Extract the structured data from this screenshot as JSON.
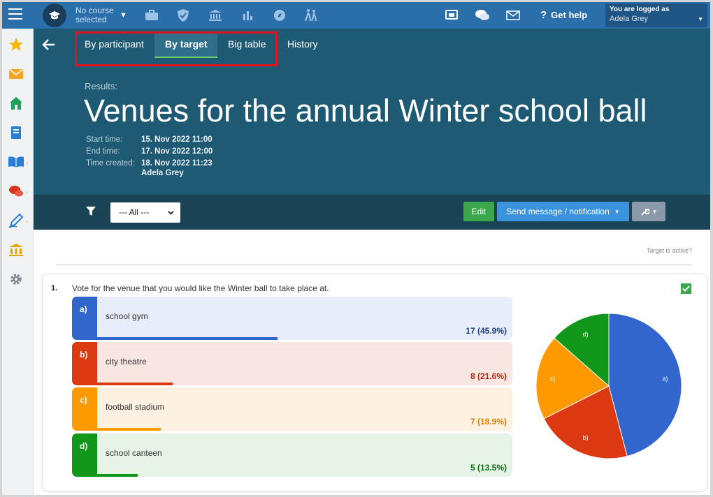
{
  "topbar": {
    "course_line1": "No course",
    "course_line2": "selected",
    "help_label": "Get help",
    "login_line1": "You are logged as",
    "login_user": "Adela Grey"
  },
  "tabs": [
    "By participant",
    "By target",
    "Big table",
    "History"
  ],
  "header": {
    "results_label": "Results:",
    "title": "Venues for the annual Winter school ball",
    "meta": [
      {
        "key": "Start time:",
        "value": "15. Nov 2022 11:00"
      },
      {
        "key": "End time:",
        "value": "17. Nov 2022 12:00"
      },
      {
        "key": "Time created:",
        "value": "18. Nov 2022 11:23"
      }
    ],
    "author": "Adela Grey"
  },
  "filterbar": {
    "select_value": "--- All ---",
    "edit_label": "Edit",
    "send_label": "Send message / notification"
  },
  "content": {
    "target_active": "Target is active?",
    "question_number": "1.",
    "question_text": "Vote for the venue that you would like the Winter ball to take place at.",
    "answers": [
      {
        "letter": "a)",
        "label": "school gym",
        "result": "17 (45.9%)"
      },
      {
        "letter": "b)",
        "label": "city theatre",
        "result": "8 (21.6%)"
      },
      {
        "letter": "c)",
        "label": "football stadium",
        "result": "7 (18.9%)"
      },
      {
        "letter": "d)",
        "label": "school canteen",
        "result": "5 (13.5%)"
      }
    ]
  },
  "colors": {
    "a": "#3366cc",
    "b": "#dc3912",
    "c": "#ff9900",
    "d": "#109618"
  },
  "chart_data": {
    "type": "pie",
    "categories": [
      "a)",
      "b)",
      "c)",
      "d)"
    ],
    "values": [
      17,
      8,
      7,
      5
    ]
  }
}
